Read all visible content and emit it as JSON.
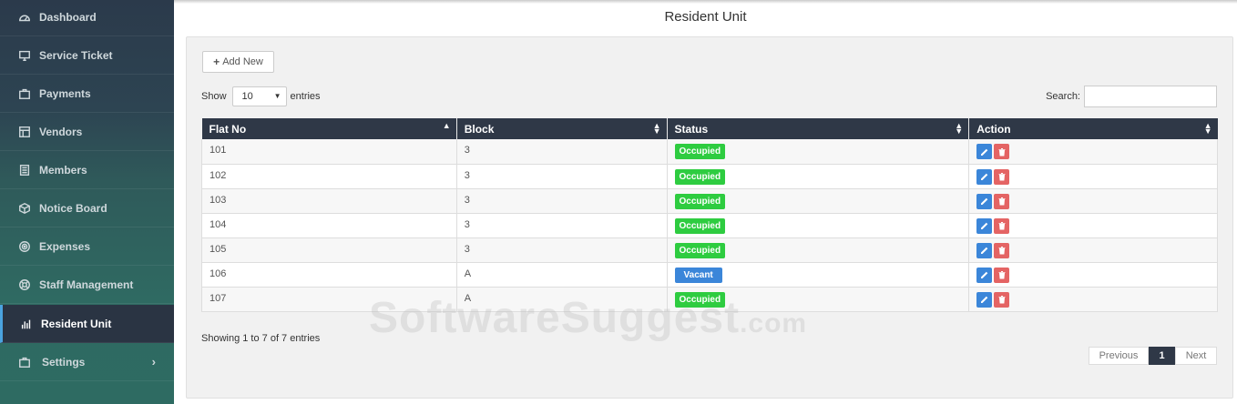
{
  "sidebar": {
    "items": [
      {
        "label": "Dashboard",
        "icon": "dashboard-icon"
      },
      {
        "label": "Service Ticket",
        "icon": "monitor-icon"
      },
      {
        "label": "Payments",
        "icon": "briefcase-icon"
      },
      {
        "label": "Vendors",
        "icon": "table-icon"
      },
      {
        "label": "Members",
        "icon": "document-icon"
      },
      {
        "label": "Notice Board",
        "icon": "cube-icon"
      },
      {
        "label": "Expenses",
        "icon": "target-icon"
      },
      {
        "label": "Staff Management",
        "icon": "lifebuoy-icon"
      },
      {
        "label": "Resident Unit",
        "icon": "bar-chart-icon",
        "active": true
      },
      {
        "label": "Settings",
        "icon": "briefcase-icon",
        "chevron": "›"
      }
    ]
  },
  "page": {
    "title": "Resident Unit"
  },
  "toolbar": {
    "add_label": "Add New",
    "show_label": "Show",
    "entries_label": "entries",
    "page_length": "10",
    "search_label": "Search:",
    "search_value": ""
  },
  "table": {
    "columns": [
      "Flat No",
      "Block",
      "Status",
      "Action"
    ],
    "rows": [
      {
        "flat": "101",
        "block": "3",
        "status": "Occupied"
      },
      {
        "flat": "102",
        "block": "3",
        "status": "Occupied"
      },
      {
        "flat": "103",
        "block": "3",
        "status": "Occupied"
      },
      {
        "flat": "104",
        "block": "3",
        "status": "Occupied"
      },
      {
        "flat": "105",
        "block": "3",
        "status": "Occupied"
      },
      {
        "flat": "106",
        "block": "A",
        "status": "Vacant"
      },
      {
        "flat": "107",
        "block": "A",
        "status": "Occupied"
      }
    ]
  },
  "footer": {
    "info": "Showing 1 to 7 of 7 entries",
    "prev_label": "Previous",
    "current_page": "1",
    "next_label": "Next"
  },
  "watermark": {
    "main": "SoftwareSuggest",
    "suffix": ".com"
  },
  "colors": {
    "header_bg": "#2f3847",
    "occupied": "#2ecc40",
    "vacant": "#3b86d9",
    "edit": "#3b86d9",
    "delete": "#e46464"
  }
}
